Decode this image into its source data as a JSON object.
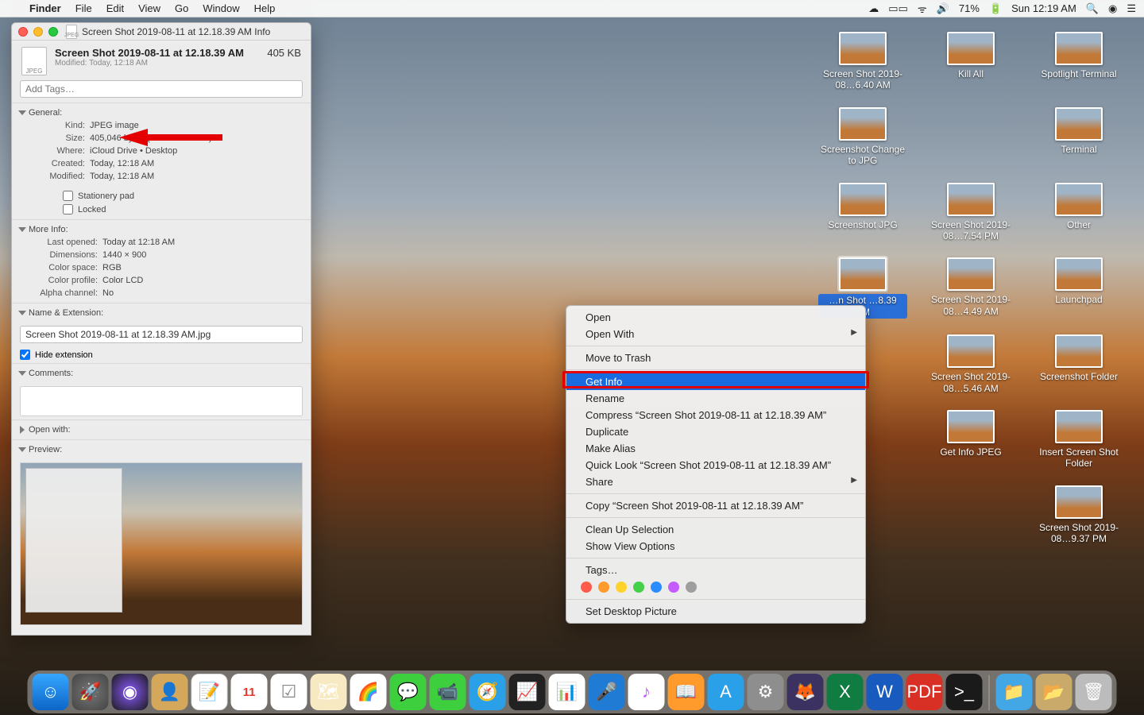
{
  "menubar": {
    "app": "Finder",
    "items": [
      "File",
      "Edit",
      "View",
      "Go",
      "Window",
      "Help"
    ],
    "battery": "71%",
    "clock": "Sun 12:19 AM"
  },
  "info_window": {
    "title": "Screen Shot 2019-08-11 at 12.18.39 AM Info",
    "filename": "Screen Shot 2019-08-11 at 12.18.39 AM",
    "modified_sub": "Modified: Today, 12:18 AM",
    "filesize": "405 KB",
    "tags_placeholder": "Add Tags…",
    "sections": {
      "general_label": "General:",
      "general": {
        "kind_label": "Kind:",
        "kind": "JPEG image",
        "size_label": "Size:",
        "size": "405,046 bytes (406 KB on disk)",
        "where_label": "Where:",
        "where": "iCloud Drive • Desktop",
        "created_label": "Created:",
        "created": "Today, 12:18 AM",
        "modified_label": "Modified:",
        "modified": "Today, 12:18 AM",
        "stationery": "Stationery pad",
        "locked": "Locked"
      },
      "more_label": "More Info:",
      "more": {
        "last_opened_label": "Last opened:",
        "last_opened": "Today at 12:18 AM",
        "dimensions_label": "Dimensions:",
        "dimensions": "1440 × 900",
        "color_space_label": "Color space:",
        "color_space": "RGB",
        "color_profile_label": "Color profile:",
        "color_profile": "Color LCD",
        "alpha_label": "Alpha channel:",
        "alpha": "No"
      },
      "name_ext_label": "Name & Extension:",
      "name_ext_value": "Screen Shot 2019-08-11 at 12.18.39 AM.jpg",
      "hide_ext": "Hide extension",
      "comments_label": "Comments:",
      "open_with_label": "Open with:",
      "preview_label": "Preview:"
    }
  },
  "context_menu": {
    "open": "Open",
    "open_with": "Open With",
    "move_trash": "Move to Trash",
    "get_info": "Get Info",
    "rename": "Rename",
    "compress": "Compress “Screen Shot 2019-08-11 at 12.18.39 AM”",
    "duplicate": "Duplicate",
    "make_alias": "Make Alias",
    "quick_look": "Quick Look “Screen Shot 2019-08-11 at 12.18.39 AM”",
    "share": "Share",
    "copy": "Copy “Screen Shot 2019-08-11 at 12.18.39 AM”",
    "clean_up": "Clean Up Selection",
    "view_opts": "Show View Options",
    "tags": "Tags…",
    "set_desktop": "Set Desktop Picture"
  },
  "desktop_icons": [
    {
      "label": "Screen Shot 2019-08…6.40 AM"
    },
    {
      "label": "Kill All"
    },
    {
      "label": "Spotlight Terminal"
    },
    {
      "label": "Screenshot Change to JPG"
    },
    {
      "label": ""
    },
    {
      "label": "Terminal"
    },
    {
      "label": "Screenshot JPG"
    },
    {
      "label": "Screen Shot 2019-08…7.54 PM"
    },
    {
      "label": "Other"
    },
    {
      "label": "…n Shot …8.39 AM",
      "selected": true
    },
    {
      "label": "Screen Shot 2019-08…4.49 AM"
    },
    {
      "label": "Launchpad"
    },
    {
      "label": ""
    },
    {
      "label": "Screen Shot 2019-08…5.46 AM"
    },
    {
      "label": "Screenshot Folder"
    },
    {
      "label": ""
    },
    {
      "label": "Get Info JPEG"
    },
    {
      "label": "Insert Screen Shot Folder"
    },
    {
      "label": ""
    },
    {
      "label": ""
    },
    {
      "label": "Screen Shot 2019-08…9.37 PM"
    }
  ],
  "tag_colors": [
    "#ff5b4a",
    "#ff9a2c",
    "#ffd22e",
    "#44d049",
    "#2b8cff",
    "#c35bff",
    "#9e9e9e"
  ]
}
